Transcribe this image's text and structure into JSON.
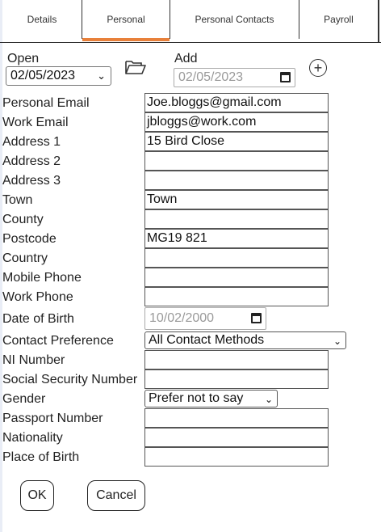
{
  "tabs": {
    "details": "Details",
    "personal": "Personal",
    "personal_contacts": "Personal Contacts",
    "payroll": "Payroll"
  },
  "toolbar": {
    "open_label": "Open",
    "open_value": "02/05/2023",
    "add_label": "Add",
    "add_date_value": "02/05/2023"
  },
  "form": {
    "personal_email": {
      "label": "Personal Email",
      "value": "Joe.bloggs@gmail.com"
    },
    "work_email": {
      "label": "Work Email",
      "value": "jbloggs@work.com"
    },
    "address1": {
      "label": "Address 1",
      "value": "15 Bird Close"
    },
    "address2": {
      "label": "Address 2",
      "value": ""
    },
    "address3": {
      "label": "Address 3",
      "value": ""
    },
    "town": {
      "label": "Town",
      "value": "Town"
    },
    "county": {
      "label": "County",
      "value": ""
    },
    "postcode": {
      "label": "Postcode",
      "value": "MG19 821"
    },
    "country": {
      "label": "Country",
      "value": ""
    },
    "mobile_phone": {
      "label": "Mobile Phone",
      "value": ""
    },
    "work_phone": {
      "label": "Work Phone",
      "value": ""
    },
    "dob": {
      "label": "Date of Birth",
      "value": "10/02/2000"
    },
    "contact_pref": {
      "label": "Contact Preference",
      "value": "All Contact Methods"
    },
    "ni_number": {
      "label": "NI Number",
      "value": ""
    },
    "ssn": {
      "label": "Social Security Number",
      "value": ""
    },
    "gender": {
      "label": "Gender",
      "value": "Prefer not to say"
    },
    "passport": {
      "label": "Passport Number",
      "value": ""
    },
    "nationality": {
      "label": "Nationality",
      "value": ""
    },
    "place_of_birth": {
      "label": "Place of Birth",
      "value": ""
    }
  },
  "buttons": {
    "ok": "OK",
    "cancel": "Cancel"
  },
  "colors": {
    "active_tab_accent": "#e8803a"
  }
}
